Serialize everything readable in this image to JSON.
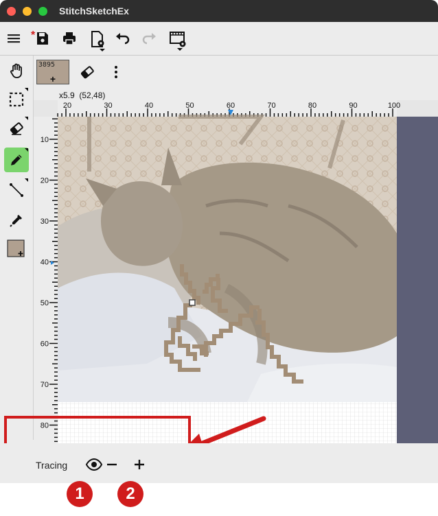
{
  "app": {
    "title": "StitchSketchEx"
  },
  "colors": {
    "accent_red": "#d01c1c",
    "highlight_green": "#7bd46d",
    "thread_color": "#b0a090"
  },
  "toolbar": {
    "icons": [
      "menu-icon",
      "save-icon",
      "print-icon",
      "document-settings-icon",
      "undo-icon",
      "redo-icon",
      "export-settings-icon"
    ]
  },
  "tools": {
    "items": [
      "hand-icon",
      "selection-icon",
      "eraser-icon",
      "pencil-icon",
      "line-icon",
      "eyedropper-icon",
      "color-swatch-icon"
    ],
    "active": "pencil-icon"
  },
  "subtoolbar": {
    "thread_number": "3895",
    "thread_add": "+"
  },
  "status": {
    "zoom": "x5.9",
    "coordinates": "(52,48)"
  },
  "ruler": {
    "top": [
      "20",
      "30",
      "40",
      "50",
      "60",
      "70",
      "80",
      "90",
      "100"
    ],
    "left": [
      "10",
      "20",
      "30",
      "40",
      "50",
      "60",
      "70",
      "80"
    ]
  },
  "bottom": {
    "tracing_label": "Tracing"
  },
  "annotations": {
    "badge_1": "1",
    "badge_2": "2"
  }
}
